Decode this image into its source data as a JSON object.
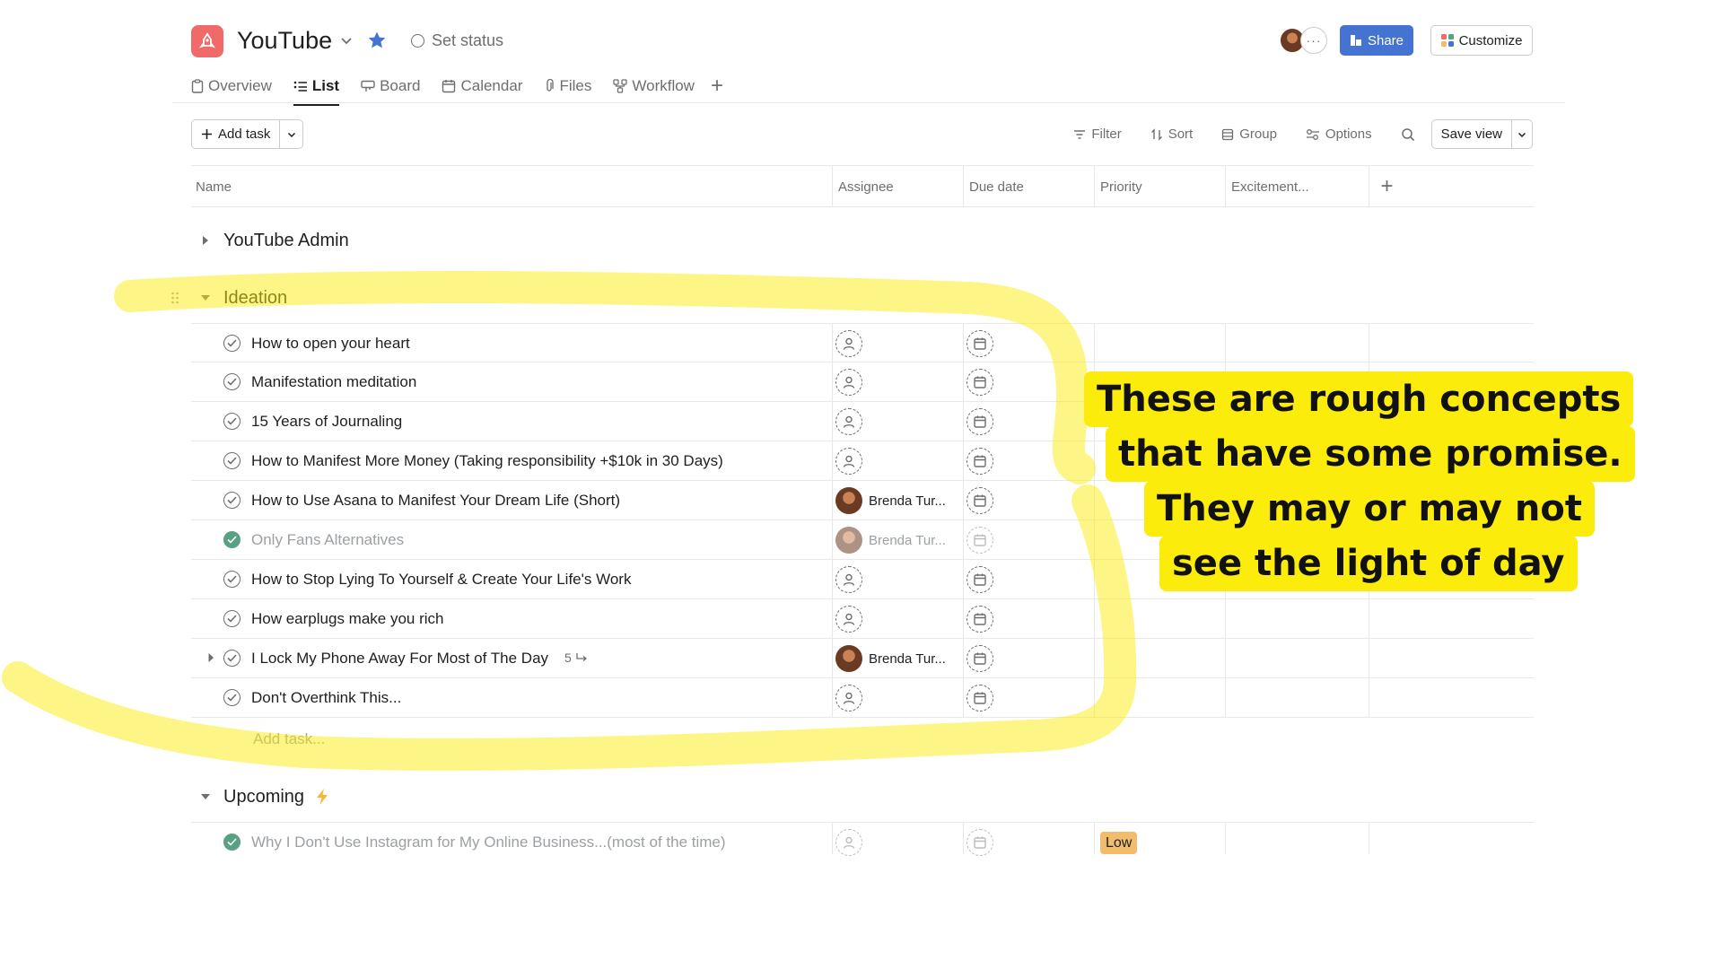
{
  "header": {
    "project_title": "YouTube",
    "set_status": "Set status",
    "share_label": "Share",
    "customize_label": "Customize",
    "avatar_more": "···",
    "tabs": [
      {
        "label": "Overview",
        "icon": "clipboard-icon"
      },
      {
        "label": "List",
        "icon": "list-icon",
        "active": true
      },
      {
        "label": "Board",
        "icon": "board-icon"
      },
      {
        "label": "Calendar",
        "icon": "calendar-icon"
      },
      {
        "label": "Files",
        "icon": "paperclip-icon"
      },
      {
        "label": "Workflow",
        "icon": "workflow-icon"
      }
    ]
  },
  "toolbar": {
    "add_task_label": "Add task",
    "filter_label": "Filter",
    "sort_label": "Sort",
    "group_label": "Group",
    "options_label": "Options",
    "save_view_label": "Save view"
  },
  "columns": {
    "name": "Name",
    "assignee": "Assignee",
    "due_date": "Due date",
    "priority": "Priority",
    "excitement": "Excitement..."
  },
  "sections": {
    "admin": {
      "title": "YouTube Admin"
    },
    "ideation": {
      "title": "Ideation",
      "tasks": [
        {
          "name": "How to open your heart"
        },
        {
          "name": "Manifestation meditation"
        },
        {
          "name": "15 Years of Journaling"
        },
        {
          "name": "How to Manifest More Money (Taking responsibility +$10k in 30 Days)"
        },
        {
          "name": "How to Use Asana to Manifest Your Dream Life (Short)",
          "assignee": "Brenda Tur..."
        },
        {
          "name": "Only Fans Alternatives",
          "assignee": "Brenda Tur...",
          "completed": true
        },
        {
          "name": "How to Stop Lying To Yourself & Create Your Life's Work"
        },
        {
          "name": "How earplugs make you rich"
        },
        {
          "name": "I Lock My Phone Away For Most of The Day",
          "assignee": "Brenda Tur...",
          "subtasks": "5"
        },
        {
          "name": "Don't Overthink This..."
        }
      ],
      "add_task_placeholder": "Add task..."
    },
    "upcoming": {
      "title": "Upcoming",
      "tasks": [
        {
          "name": "Why I Don't Use Instagram for My Online Business...(most of the time)",
          "completed": true,
          "priority": "Low"
        }
      ]
    }
  },
  "annotation": {
    "lines": [
      "These are  rough concepts",
      "that have some promise.",
      "They may or may not",
      "see the light of day"
    ],
    "highlight_color": "#fcec0c"
  },
  "colors": {
    "brand_coral": "#f06a6a",
    "share_blue": "#4573d2",
    "complete_green": "#58a182",
    "priority_low": "#f1bd6c"
  }
}
